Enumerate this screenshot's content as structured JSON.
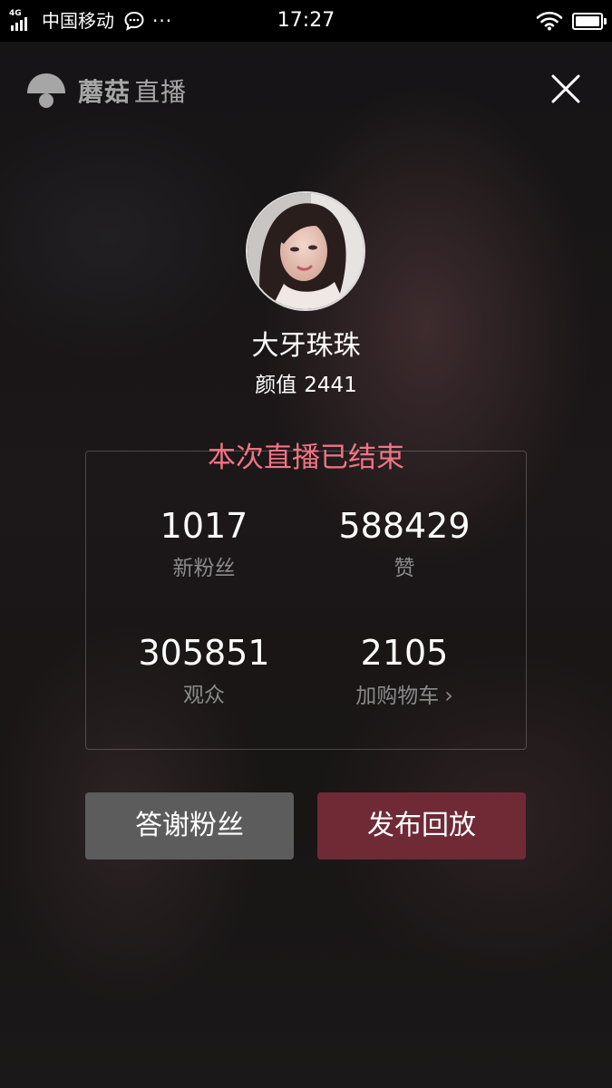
{
  "status_bar": {
    "network": "4G",
    "carrier": "中国移动",
    "dots": "···",
    "time": "17:27",
    "icons": [
      "signal-icon",
      "message-icon",
      "wifi-icon",
      "battery-icon"
    ]
  },
  "header": {
    "brand_name": "蘑菇",
    "brand_sub": "直播",
    "icons": [
      "mushroom-logo-icon",
      "close-icon"
    ]
  },
  "profile": {
    "username": "大牙珠珠",
    "beauty_label": "颜值",
    "beauty_value": "2441"
  },
  "summary": {
    "title": "本次直播已结束",
    "stats": [
      {
        "value": "1017",
        "label": "新粉丝"
      },
      {
        "value": "588429",
        "label": "赞"
      },
      {
        "value": "305851",
        "label": "观众"
      },
      {
        "value": "2105",
        "label": "加购物车"
      }
    ]
  },
  "actions": {
    "thanks_label": "答谢粉丝",
    "replay_label": "发布回放"
  },
  "colors": {
    "accent_pink": "#ef7584",
    "replay_button": "#6f2a36",
    "thanks_button": "#5c5c5d",
    "status_bar": "#000000"
  }
}
